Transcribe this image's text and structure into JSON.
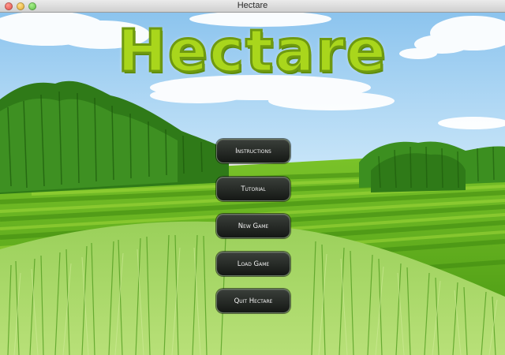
{
  "window": {
    "title": "Hectare"
  },
  "game": {
    "logo": "Hectare"
  },
  "menu": {
    "instructions": "Instructions",
    "tutorial": "Tutorial",
    "new_game": "New Game",
    "load_game": "Load Game",
    "quit": "Quit Hectare"
  },
  "colors": {
    "logo_fill": "#a9d61c",
    "button_bg": "#1e221e",
    "sky": "#a8d4f2",
    "field": "#5aac1a"
  }
}
